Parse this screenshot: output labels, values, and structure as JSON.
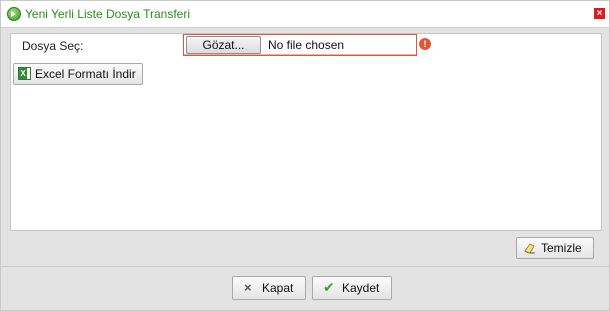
{
  "dialog": {
    "title": "Yeni Yerli Liste Dosya Transferi",
    "close_symbol": "×",
    "title_icon": "add-circle-icon"
  },
  "form": {
    "file_label": "Dosya Seç:",
    "browse_label": "Gözat...",
    "file_status": "No file chosen",
    "error_symbol": "!",
    "excel_button_label": "Excel Formatı İndir"
  },
  "actions": {
    "clear_label": "Temizle",
    "close_label": "Kapat",
    "close_symbol": "×",
    "save_label": "Kaydet",
    "save_symbol": "✔"
  },
  "colors": {
    "title_text": "#2e8a1a",
    "error": "#e0563b",
    "close_button": "#d81e1e"
  }
}
